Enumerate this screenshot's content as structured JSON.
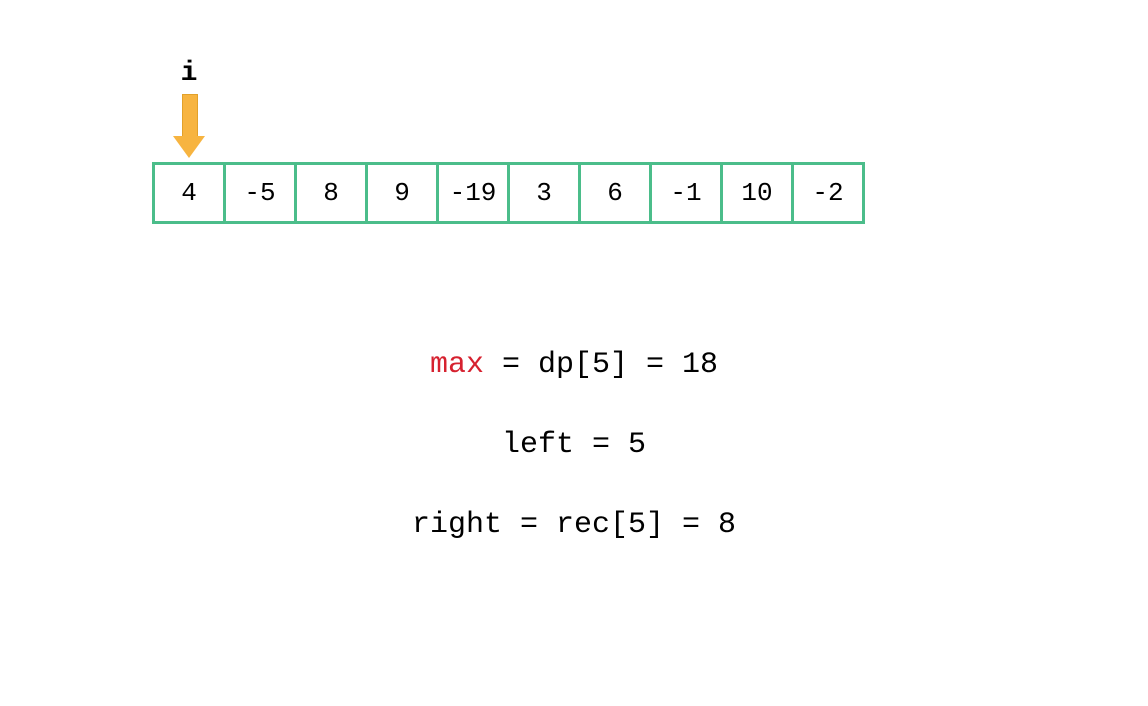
{
  "pointer": {
    "label": "i",
    "index": 0
  },
  "array": {
    "values": [
      "4",
      "-5",
      "8",
      "9",
      "-19",
      "3",
      "6",
      "-1",
      "10",
      "-2"
    ]
  },
  "formulas": {
    "line1_hl": "max",
    "line1_rest": " = dp[5] = 18",
    "line2": "left = 5",
    "line3": "right = rec[5] = 8"
  },
  "layout": {
    "arrayLeft": 152,
    "arrayTop": 162,
    "cellWidth": 74,
    "cellOverlap": 3,
    "pointerTop": 58,
    "arrowTop": 94,
    "formula1Top": 350,
    "formula2Top": 430,
    "formula3Top": 510
  },
  "colors": {
    "cellBorder": "#4bbd8a",
    "arrow": "#f7b440",
    "highlight": "#d6212f"
  }
}
